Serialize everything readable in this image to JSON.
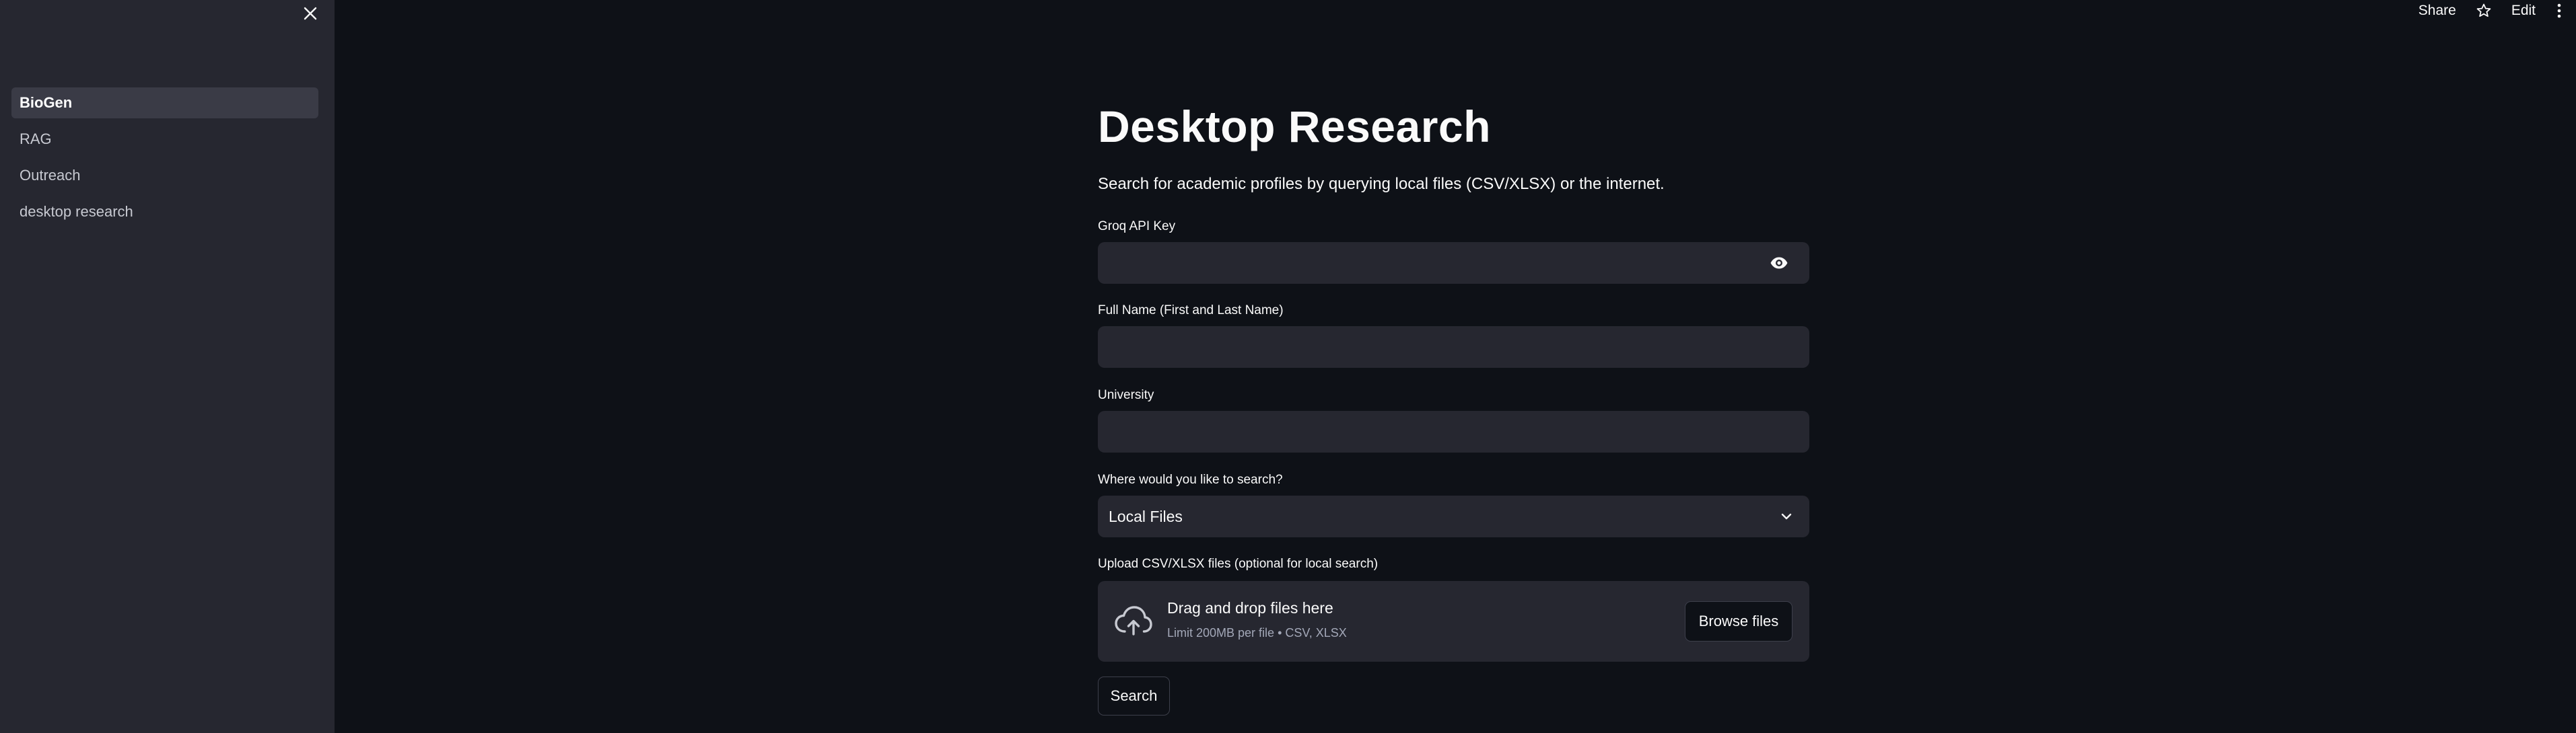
{
  "sidebar": {
    "close_icon": "close-icon",
    "items": [
      {
        "label": "BioGen",
        "active": true
      },
      {
        "label": "RAG",
        "active": false
      },
      {
        "label": "Outreach",
        "active": false
      },
      {
        "label": "desktop research",
        "active": false
      }
    ]
  },
  "header": {
    "share_label": "Share",
    "star_icon": "star-icon",
    "edit_label": "Edit",
    "menu_icon": "kebab-menu-icon"
  },
  "main": {
    "title": "Desktop Research",
    "subtitle": "Search for academic profiles by querying local files (CSV/XLSX) or the internet.",
    "api_key": {
      "label": "Groq API Key",
      "value": "",
      "placeholder": "",
      "toggle_icon": "eye-icon"
    },
    "full_name": {
      "label": "Full Name (First and Last Name)",
      "value": "",
      "placeholder": ""
    },
    "university": {
      "label": "University",
      "value": "",
      "placeholder": ""
    },
    "search_location": {
      "label": "Where would you like to search?",
      "selected": "Local Files",
      "icon": "chevron-down-icon"
    },
    "upload": {
      "label": "Upload CSV/XLSX files (optional for local search)",
      "icon": "cloud-upload-icon",
      "title": "Drag and drop files here",
      "subtitle": "Limit 200MB per file • CSV, XLSX",
      "browse_label": "Browse files"
    },
    "search_button": "Search"
  },
  "colors": {
    "background": "#0e1117",
    "sidebar": "#262730",
    "input": "#262730",
    "active_nav": "#3a3b46",
    "text": "#fafafa",
    "muted_text": "#a3a8b8"
  }
}
